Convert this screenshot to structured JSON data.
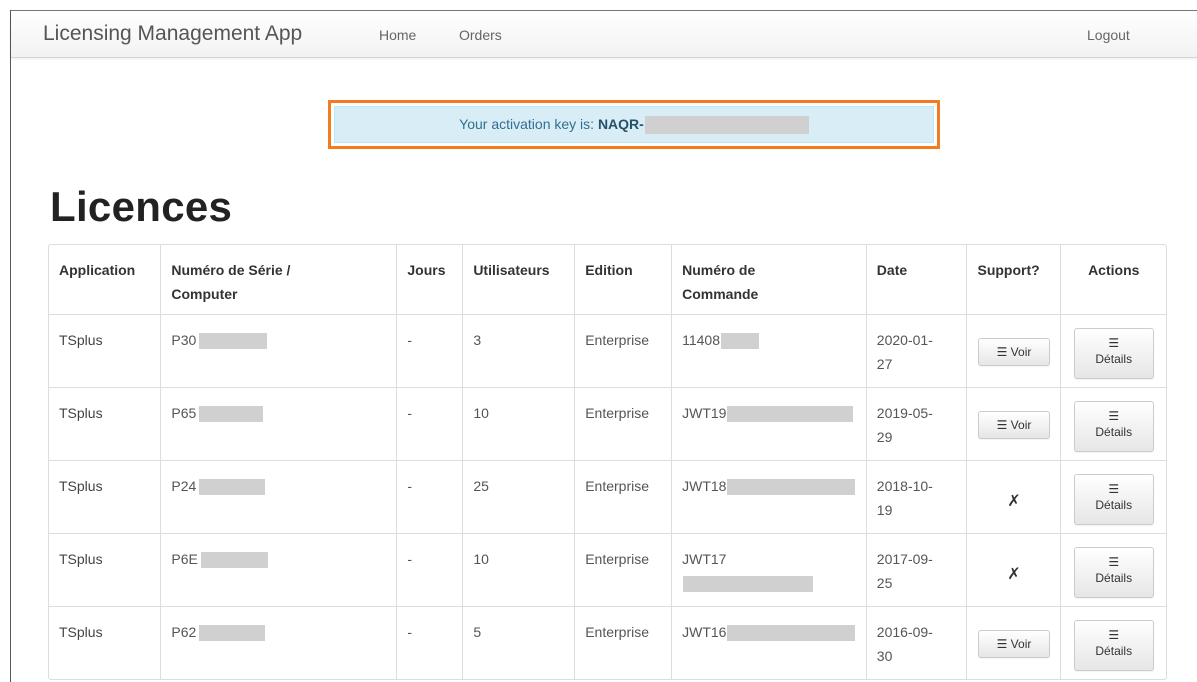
{
  "navbar": {
    "brand": "Licensing Management App",
    "home": "Home",
    "orders": "Orders",
    "logout": "Logout"
  },
  "alert": {
    "text": "Your activation key is: ",
    "key_prefix": "NAQR-"
  },
  "page_title": "Licences",
  "table": {
    "headers": {
      "application": "Application",
      "serial_line1": "Numéro de Série /",
      "serial_line2": "Computer",
      "jours": "Jours",
      "utilisateurs": "Utilisateurs",
      "edition": "Edition",
      "order_line1": "Numéro de",
      "order_line2": "Commande",
      "date": "Date",
      "support": "Support?",
      "actions": "Actions"
    },
    "rows": [
      {
        "app": "TSplus",
        "serial": "P30",
        "jours": "-",
        "users": "3",
        "edition": "Enterprise",
        "order": "11408",
        "date_line1": "2020-01-",
        "date_line2": "27",
        "support_label": "Voir",
        "details_label": "Détails"
      },
      {
        "app": "TSplus",
        "serial": "P65",
        "jours": "-",
        "users": "10",
        "edition": "Enterprise",
        "order": "JWT19",
        "date_line1": "2019-05-",
        "date_line2": "29",
        "support_label": "Voir",
        "details_label": "Détails"
      },
      {
        "app": "TSplus",
        "serial": "P24",
        "jours": "-",
        "users": "25",
        "edition": "Enterprise",
        "order": "JWT18",
        "date_line1": "2018-10-",
        "date_line2": "19",
        "support_label": "✗",
        "details_label": "Détails"
      },
      {
        "app": "TSplus",
        "serial": "P6E",
        "jours": "-",
        "users": "10",
        "edition": "Enterprise",
        "order": "JWT17",
        "date_line1": "2017-09-",
        "date_line2": "25",
        "support_label": "✗",
        "details_label": "Détails"
      },
      {
        "app": "TSplus",
        "serial": "P62",
        "jours": "-",
        "users": "5",
        "edition": "Enterprise",
        "order": "JWT16",
        "date_line1": "2016-09-",
        "date_line2": "30",
        "support_label": "Voir",
        "details_label": "Détails"
      }
    ]
  },
  "icons": {
    "list": "☰"
  },
  "colors": {
    "alert_bg": "#d9edf7",
    "alert_text": "#31708f",
    "highlight_border": "#f47c20"
  }
}
